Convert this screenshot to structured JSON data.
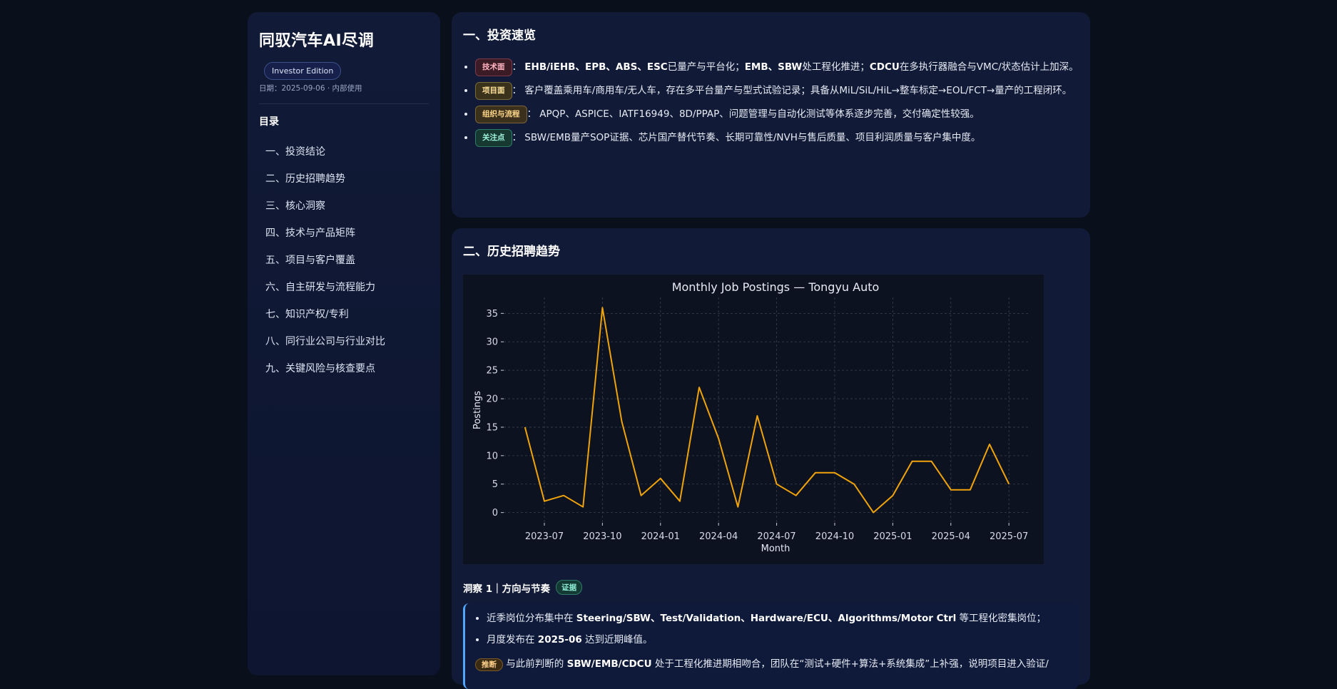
{
  "sidebar": {
    "brand": "同驭汽车AI尽调",
    "edition": "Investor Edition",
    "date": "日期：2025-09-06 · 内部使用",
    "toc_heading": "目录",
    "toc": [
      "一、投资结论",
      "二、历史招聘趋势",
      "三、核心洞察",
      "四、技术与产品矩阵",
      "五、项目与客户覆盖",
      "六、自主研发与流程能力",
      "七、知识产权/专利",
      "八、同行业公司与行业对比",
      "九、关键风险与核查要点"
    ]
  },
  "section1": {
    "title": "一、投资速览",
    "items": [
      {
        "tag": "技术面",
        "sep": "：",
        "text_bold1": "EHB/iEHB、EPB、ABS、ESC",
        "text1": "已量产与平台化；",
        "text_bold2": "EMB、SBW",
        "text2": "处工程化推进；",
        "text_bold3": "CDCU",
        "text3": "在多执行器融合与VMC/状态估计上加深。"
      },
      {
        "tag": "项目面",
        "sep": "：",
        "text": "客户覆盖乘用车/商用车/无人车，存在多平台量产与型式试验记录；具备从MiL/SiL/HiL→整车标定→EOL/FCT→量产的工程闭环。"
      },
      {
        "tag": "组织与流程",
        "sep": "：",
        "text": "APQP、ASPICE、IATF16949、8D/PPAP、问题管理与自动化测试等体系逐步完善，交付确定性较强。"
      },
      {
        "tag": "关注点",
        "sep": "：",
        "text": "SBW/EMB量产SOP证据、芯片国产替代节奏、长期可靠性/NVH与售后质量、项目利润质量与客户集中度。"
      }
    ]
  },
  "section2": {
    "title": "二、历史招聘趋势",
    "insight_title": "洞察 1｜方向与节奏",
    "evidence_tag": "证据",
    "insight_items": [
      {
        "pre": "近季岗位分布集中在 ",
        "bold": "Steering/SBW、Test/Validation、Hardware/ECU、Algorithms/Motor Ctrl",
        "post": " 等工程化密集岗位；"
      },
      {
        "pre": "月度发布在 ",
        "bold": "2025-06",
        "post": " 达到近期峰值。"
      }
    ],
    "infer_tag": "推断",
    "infer_pre": " 与此前判断的 ",
    "infer_bold": "SBW/EMB/CDCU",
    "infer_post": " 处于工程化推进期相吻合，团队在“测试+硬件+算法+系统集成”上补强，说明项目进入验证/"
  },
  "chart_data": {
    "type": "line",
    "title": "Monthly Job Postings — Tongyu Auto",
    "xlabel": "Month",
    "ylabel": "Postings",
    "x": [
      "2023-06",
      "2023-07",
      "2023-08",
      "2023-09",
      "2023-10",
      "2023-11",
      "2023-12",
      "2024-01",
      "2024-02",
      "2024-03",
      "2024-04",
      "2024-05",
      "2024-06",
      "2024-07",
      "2024-08",
      "2024-09",
      "2024-10",
      "2024-11",
      "2024-12",
      "2025-01",
      "2025-02",
      "2025-03",
      "2025-04",
      "2025-05",
      "2025-06",
      "2025-07"
    ],
    "values": [
      15,
      2,
      3,
      1,
      36,
      16,
      3,
      6,
      2,
      22,
      13,
      1,
      17,
      5,
      3,
      7,
      7,
      5,
      0,
      3,
      9,
      9,
      4,
      4,
      12,
      5
    ],
    "xticks": [
      "2023-07",
      "2023-10",
      "2024-01",
      "2024-04",
      "2024-07",
      "2024-10",
      "2025-01",
      "2025-04",
      "2025-07"
    ],
    "yticks": [
      0,
      5,
      10,
      15,
      20,
      25,
      30,
      35
    ],
    "ylim": [
      -1.8,
      37.8
    ],
    "grid": true,
    "line_color": "#f0a30a"
  }
}
